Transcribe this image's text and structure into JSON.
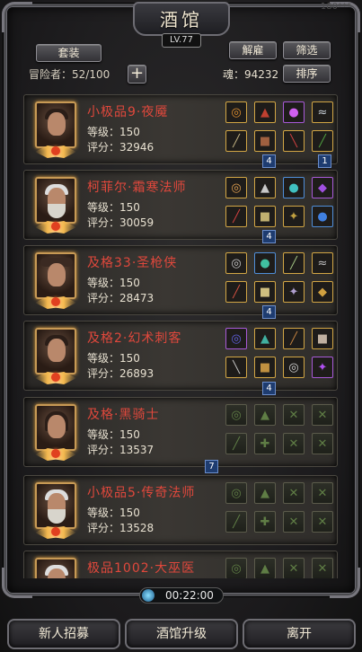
{
  "header": {
    "title": "酒馆",
    "level": "LV.77",
    "watermark": "180***"
  },
  "toolbar": {
    "set_label": "套装",
    "dismiss_label": "解雇",
    "filter_label": "筛选",
    "sort_label": "排序",
    "add_label": "+",
    "adventurer_count": "冒险者：52/100",
    "soul": "魂：94232"
  },
  "heroes": [
    {
      "name": "小极品9·夜魇",
      "level": "等级：150",
      "score": "评分：32946"
    },
    {
      "name": "柯菲尔·霜寒法师",
      "level": "等级：150",
      "score": "评分：30059"
    },
    {
      "name": "及格33·圣枪侠",
      "level": "等级：150",
      "score": "评分：28473"
    },
    {
      "name": "及格2·幻术刺客",
      "level": "等级：150",
      "score": "评分：26893"
    },
    {
      "name": "及格·黑骑士",
      "level": "等级：150",
      "score": "评分：13537"
    },
    {
      "name": "小极品5·传奇法师",
      "level": "等级：150",
      "score": "评分：13528"
    },
    {
      "name": "极品1002·大巫医",
      "level": "",
      "score": ""
    }
  ],
  "markers": [
    "4",
    "1",
    "4",
    "4",
    "4",
    "7"
  ],
  "timer": "00:22:00",
  "bottom": {
    "recruit_label": "新人招募",
    "upgrade_label": "酒馆升级",
    "leave_label": "离开"
  },
  "colors": {
    "hero_name": "#e0483c",
    "accent_gold": "#d2a645",
    "marker_blue": "#1e3c70"
  }
}
